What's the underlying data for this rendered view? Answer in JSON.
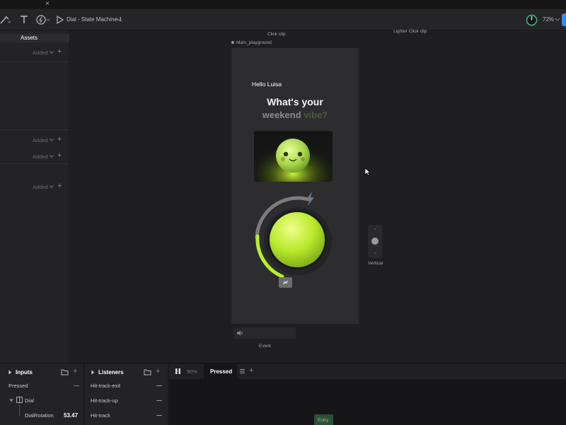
{
  "app": {
    "close_glyph": "×"
  },
  "toolbar": {
    "breadcrumb": "Dial - State Machine 1",
    "zoom": "72%",
    "accent": "#2f8cff"
  },
  "assets_panel": {
    "title": "Assets",
    "added_label": "Added",
    "rows": [
      "Added",
      "Added",
      "Added",
      "Added"
    ]
  },
  "canvas": {
    "labels": {
      "click_clip": "Click clip",
      "lighter_click_clip": "Lighter Click clip",
      "artboard_name": "Main_playground",
      "vertical": "Vertical",
      "event": "Event"
    },
    "artboard": {
      "greeting": "Hello Luisa",
      "headline_line1": "What's your",
      "headline_line2_a": "weekend",
      "headline_line2_b": "vibe?"
    },
    "colors": {
      "lime": "#b7f03a",
      "artboard_bg": "#2d2d2f"
    }
  },
  "bottom": {
    "inputs": {
      "title": "Inputs",
      "items": [
        {
          "label": "Pressed",
          "value": ""
        },
        {
          "label": "Dial",
          "value": ""
        },
        {
          "label": "DialRotation",
          "value": "53.47"
        }
      ]
    },
    "listeners": {
      "title": "Listeners",
      "items": [
        "Hit-track-exit",
        "Hit-track-up",
        "Hit-track"
      ]
    },
    "timeline": {
      "speed": "90%",
      "tab": "Pressed",
      "entry_node": "Entry"
    }
  }
}
